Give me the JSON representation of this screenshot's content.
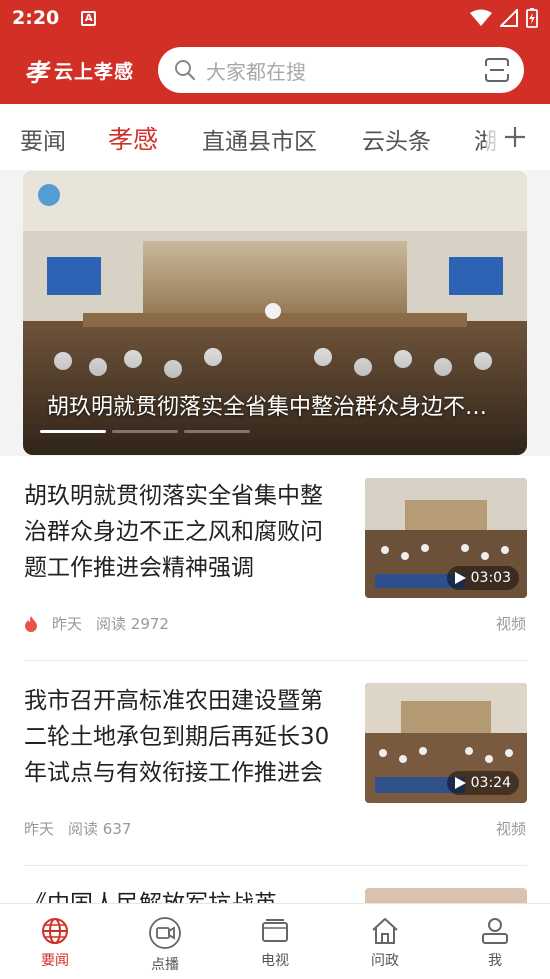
{
  "status_bar": {
    "time": "2:20",
    "app_icon_letter": "A"
  },
  "header": {
    "logo_text": "云上孝感",
    "search_placeholder": "大家都在搜"
  },
  "tabs": [
    {
      "label": "要闻"
    },
    {
      "label": "孝感"
    },
    {
      "label": "直通县市区"
    },
    {
      "label": "云头条"
    },
    {
      "label": "湖"
    }
  ],
  "banner": {
    "title": "胡玖明就贯彻落实全省集中整治群众身边不正之风和腐败问题工作推进会精神强调",
    "page_index": 1,
    "page_count": 3
  },
  "news": [
    {
      "title": "胡玖明就贯彻落实全省集中整治群众身边不正之风和腐败问题工作推进会精神强调",
      "hot": true,
      "time": "昨天",
      "reads": "阅读 2972",
      "tag": "视频",
      "duration": "03:03"
    },
    {
      "title": "我市召开高标准农田建设暨第二轮土地承包到期后再延长30年试点与有效衔接工作推进会",
      "hot": false,
      "time": "昨天",
      "reads": "阅读 637",
      "tag": "视频",
      "duration": "03:24"
    },
    {
      "title": "《中国人民解放军抗战英",
      "hot": false
    }
  ],
  "bottom_nav": [
    {
      "label": "要闻",
      "icon": "globe-icon"
    },
    {
      "label": "点播",
      "icon": "video-camera-icon"
    },
    {
      "label": "电视",
      "icon": "tv-icon"
    },
    {
      "label": "问政",
      "icon": "home-icon"
    },
    {
      "label": "我",
      "icon": "user-icon"
    }
  ],
  "colors": {
    "brand": "#d22f27",
    "text": "#222222",
    "muted": "#999999"
  }
}
